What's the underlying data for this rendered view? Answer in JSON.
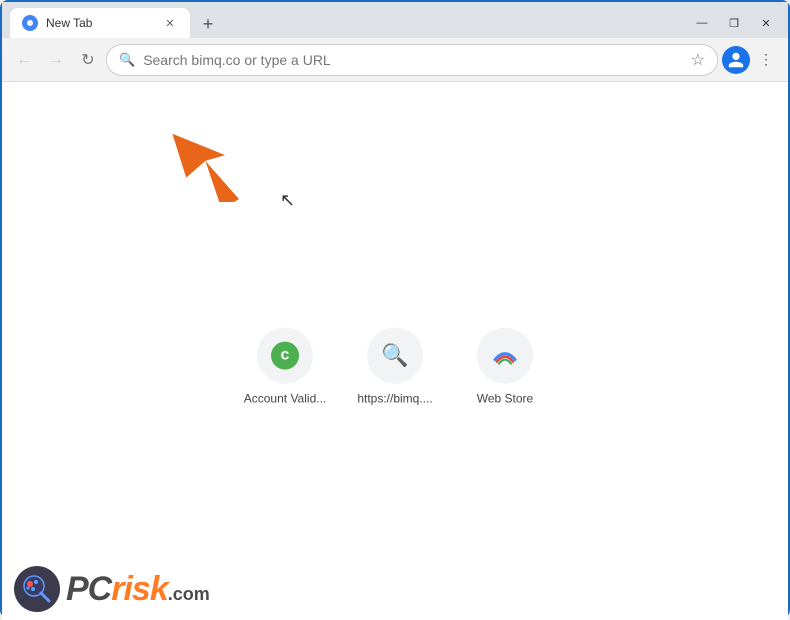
{
  "titlebar": {
    "tab_title": "New Tab",
    "new_tab_label": "+",
    "win_minimize": "—",
    "win_restore": "❐",
    "win_close": "✕"
  },
  "toolbar": {
    "back_label": "←",
    "forward_label": "→",
    "refresh_label": "↻",
    "address_placeholder": "Search bimq.co or type a URL",
    "address_value": "Search bimq.co or type a URL"
  },
  "shortcuts": [
    {
      "label": "Account Valid...",
      "type": "letter",
      "letter": "c",
      "color": "#4CAF50"
    },
    {
      "label": "https://bimq....",
      "type": "search"
    },
    {
      "label": "Web Store",
      "type": "webstore"
    }
  ],
  "watermark": {
    "pc": "PC",
    "risk": "risk",
    "dot_com": ".com"
  }
}
